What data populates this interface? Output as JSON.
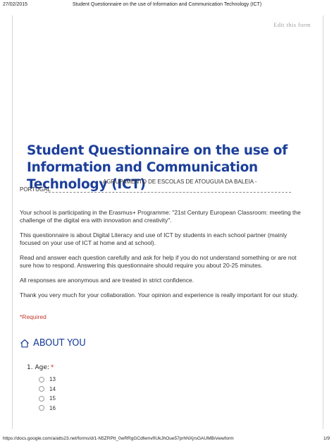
{
  "print_header": {
    "date": "27/02/2015",
    "title": "Student Questionnaire on the use of Information and Communication Technology (ICT)"
  },
  "edit_link": "Edit this form",
  "form": {
    "title": "Student Questionnaire on the use of Information and Communication Technology (ICT)",
    "school_line1": "AGRUPAMENTO DE ESCOLAS DE ATOUGUIA DA BALEIA -",
    "school_line2": "PORTUGAL",
    "description": [
      "Your school is participating in the Erasmus+ Programme: \"21st Century European Classroom: meeting the challenge of the digital era with innovation and creativity\".",
      "This questionnaire is about Digital Literacy and use of ICT by students in each school partner (mainly focused on your use of ICT at home and at school).",
      "Read and answer each question carefully and ask for help if you do not understand something or are not sure how to respond. Answering this questionnaire should require you about 20-25 minutes.",
      "All responses are anonymous and are treated in strict confidence.",
      "Thank you very much for your collaboration. Your opinion and experience is really important for our study."
    ],
    "required_note": "*Required",
    "section_title": "ABOUT YOU",
    "question": {
      "label": "1. Age:",
      "required_mark": "*",
      "options": [
        "13",
        "14",
        "15",
        "16"
      ]
    }
  },
  "print_footer": {
    "url": "https://docs.google.com/a/atts23.net/forms/d/1-N5ZRPtt_0wRRgGCdfemvfIUkJhOue57prhNXjrsGAUMB/viewform",
    "page": "1/9"
  },
  "colors": {
    "title_blue": "#1c3f9a",
    "required_red": "#c0392b"
  },
  "icons": {
    "section": "home-icon"
  }
}
